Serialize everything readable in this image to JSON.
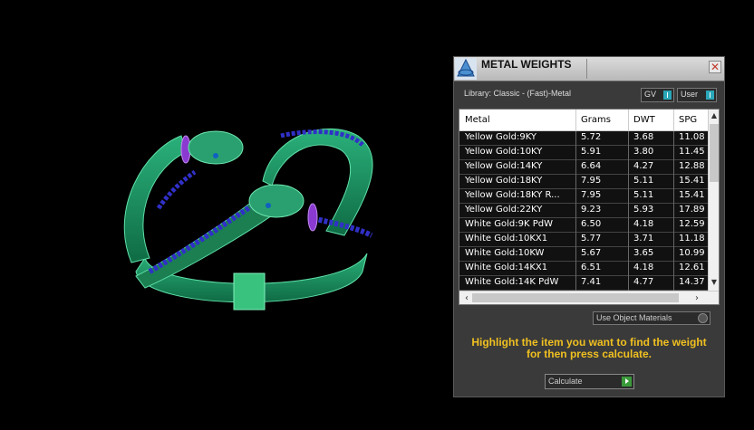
{
  "window": {
    "title": "METAL WEIGHTS",
    "close_glyph": "✕"
  },
  "library_label": "Library: Classic - (Fast)-Metal",
  "toggles": {
    "gv": "GV",
    "user": "User"
  },
  "table": {
    "columns": [
      "Metal",
      "Grams",
      "DWT",
      "SPG"
    ],
    "rows": [
      {
        "metal": "Yellow Gold:9KY",
        "grams": "5.72",
        "dwt": "3.68",
        "spg": "11.08"
      },
      {
        "metal": "Yellow Gold:10KY",
        "grams": "5.91",
        "dwt": "3.80",
        "spg": "11.45"
      },
      {
        "metal": "Yellow Gold:14KY",
        "grams": "6.64",
        "dwt": "4.27",
        "spg": "12.88"
      },
      {
        "metal": "Yellow Gold:18KY",
        "grams": "7.95",
        "dwt": "5.11",
        "spg": "15.41"
      },
      {
        "metal": "Yellow Gold:18KY R...",
        "grams": "7.95",
        "dwt": "5.11",
        "spg": "15.41"
      },
      {
        "metal": "Yellow Gold:22KY",
        "grams": "9.23",
        "dwt": "5.93",
        "spg": "17.89"
      },
      {
        "metal": "White Gold:9K PdW",
        "grams": "6.50",
        "dwt": "4.18",
        "spg": "12.59"
      },
      {
        "metal": "White Gold:10KX1",
        "grams": "5.77",
        "dwt": "3.71",
        "spg": "11.18"
      },
      {
        "metal": "White Gold:10KW",
        "grams": "5.67",
        "dwt": "3.65",
        "spg": "10.99"
      },
      {
        "metal": "White Gold:14KX1",
        "grams": "6.51",
        "dwt": "4.18",
        "spg": "12.61"
      },
      {
        "metal": "White Gold:14K PdW",
        "grams": "7.41",
        "dwt": "4.77",
        "spg": "14.37"
      }
    ]
  },
  "use_object_materials": "Use Object Materials",
  "message_line1": "Highlight the item you want to find the weight",
  "message_line2": "for then press calculate.",
  "calculate_label": "Calculate",
  "icons": {
    "window_logo": "rhino-logo-icon",
    "close": "close-icon"
  },
  "colors": {
    "viewport_bg": "#000000",
    "panel_bg": "#3a3a3a",
    "ring_green": "#1a8a5a",
    "gem_blue": "#2a2aaa",
    "accent_message": "#f0c020"
  }
}
